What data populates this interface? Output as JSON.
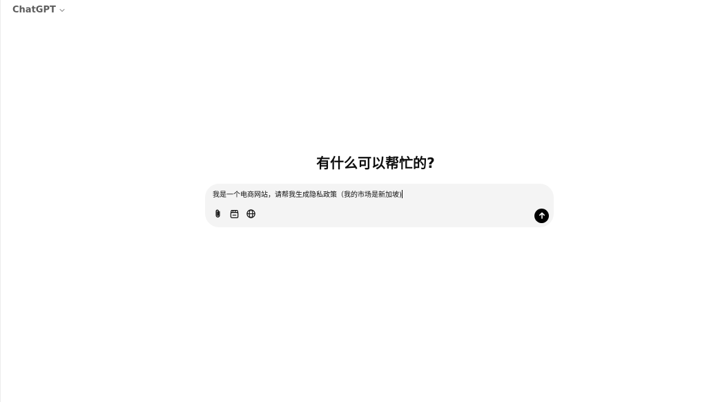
{
  "header": {
    "model_name": "ChatGPT",
    "dropdown_icon": "chevron-down-icon"
  },
  "main": {
    "headline": "有什么可以帮忙的?"
  },
  "composer": {
    "input_value": "我是一个电商网站，请帮我生成隐私政策（我的市场是新加坡)",
    "tools": [
      {
        "icon": "paperclip-icon"
      },
      {
        "icon": "clapperboard-icon"
      },
      {
        "icon": "globe-icon"
      }
    ],
    "send_icon": "arrow-up-icon"
  },
  "colors": {
    "composer_bg": "#f4f4f4",
    "send_button": "#000000",
    "model_name": "#5d5d5d"
  }
}
